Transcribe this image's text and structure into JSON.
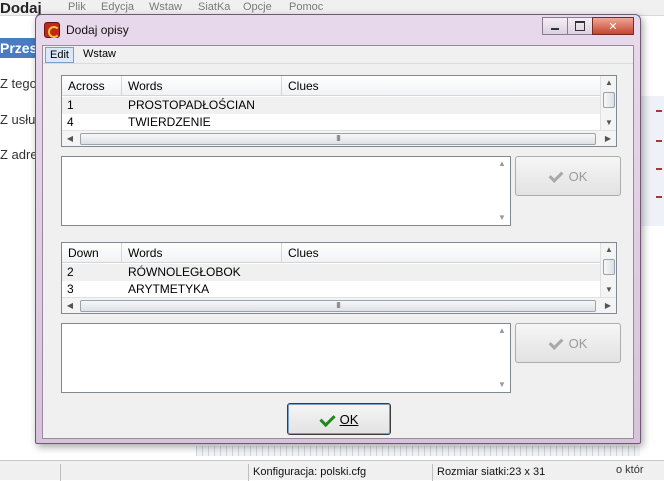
{
  "background": {
    "title_fragment": "Dodaj",
    "menu": [
      "Plik",
      "Edycja",
      "Wstaw",
      "SiatKa",
      "Opcje",
      "Pomoc"
    ],
    "blue_label": "Przes",
    "lines": [
      "Z tego",
      "Z usłu",
      "Z adre"
    ],
    "status": {
      "config": "Konfiguracja: polski.cfg",
      "grid_size": "Rozmiar siatki:23 x 31",
      "tail": "o któr"
    }
  },
  "dialog": {
    "title": "Dodaj opisy",
    "menu": [
      "Edit",
      "Wstaw"
    ],
    "across": {
      "headers": [
        "Across",
        "Words",
        "Clues"
      ],
      "rows": [
        {
          "num": "1",
          "word": "PROSTOPADŁOŚCIAN",
          "clue": ""
        },
        {
          "num": "4",
          "word": "TWIERDZENIE",
          "clue": ""
        }
      ]
    },
    "down": {
      "headers": [
        "Down",
        "Words",
        "Clues"
      ],
      "rows": [
        {
          "num": "2",
          "word": "RÓWNOLEGŁOBOK",
          "clue": ""
        },
        {
          "num": "3",
          "word": "ARYTMETYKA",
          "clue": ""
        }
      ]
    },
    "ok_small_label": "OK",
    "ok_label": "OK",
    "scroll_grip": "III"
  }
}
